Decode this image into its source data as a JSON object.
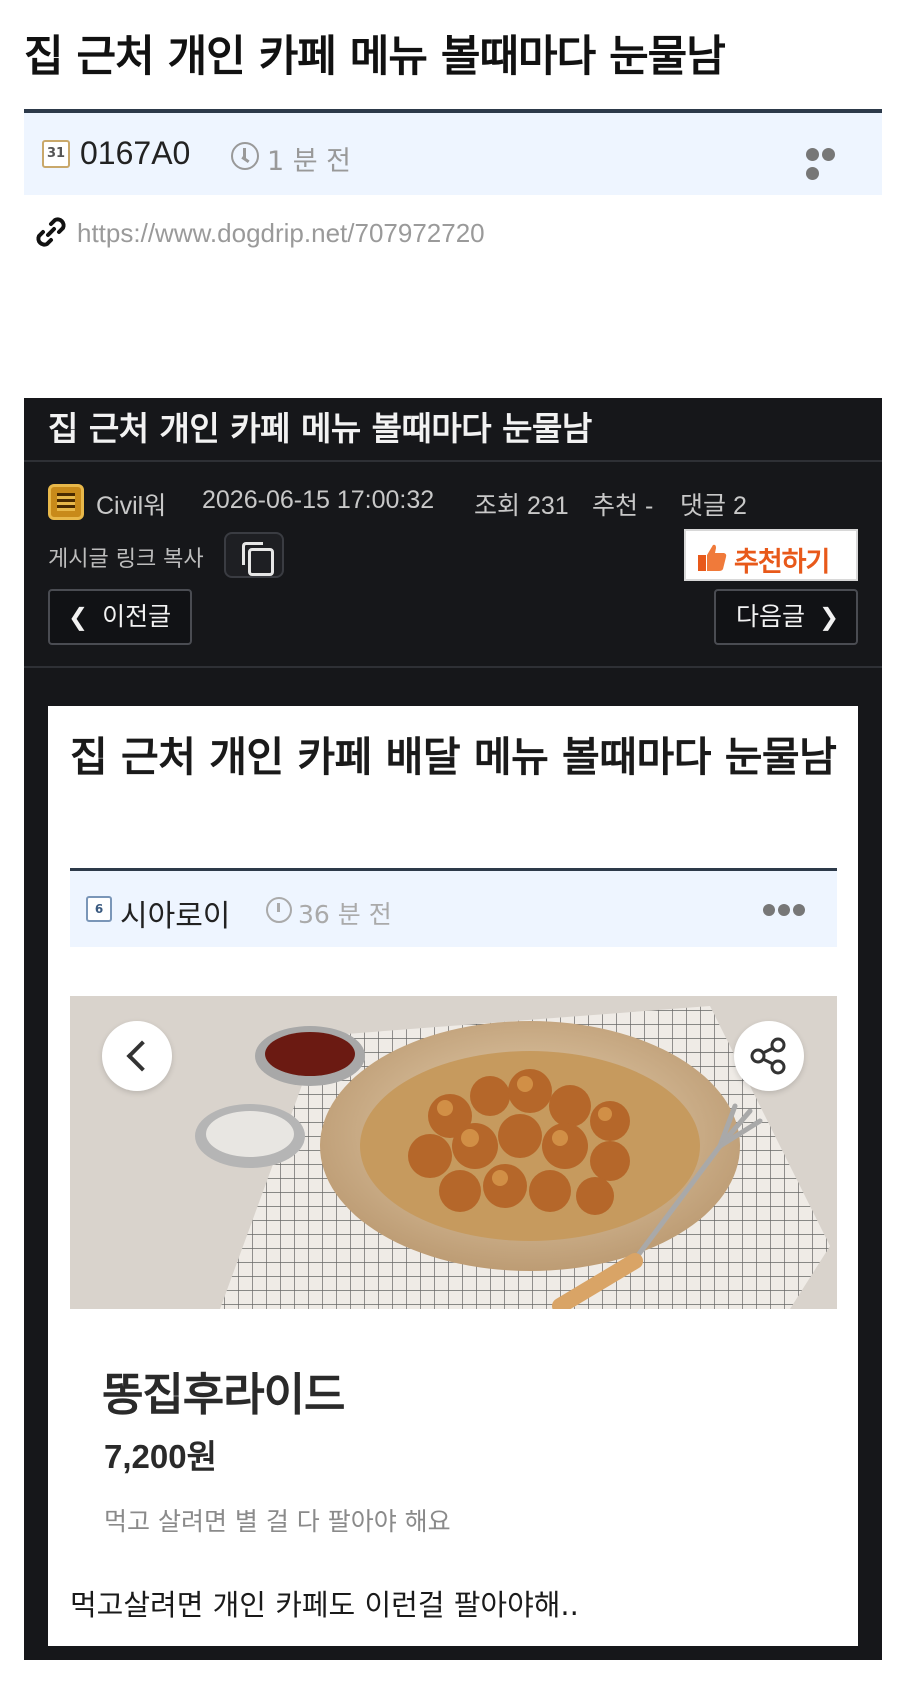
{
  "header": {
    "title": "집 근처 개인 카페 메뉴 볼때마다 눈물남",
    "level_badge": "31",
    "username": "0167A0",
    "time": "1 분 전",
    "source_url": "https://www.dogdrip.net/707972720"
  },
  "embed": {
    "title": "집 근처 개인 카페 메뉴 볼때마다 눈물남",
    "author": "Civil워",
    "datetime": "2026-06-15 17:00:32",
    "views": "조회 231",
    "recommend_count": "추천 -",
    "comments": "댓글 2",
    "copy_link_label": "게시글 링크 복사",
    "recommend_button": "추천하기",
    "prev_label": "이전글",
    "next_label": "다음글"
  },
  "inner_post": {
    "title": "집 근처 개인 카페 배달 메뉴 볼때마다 눈물남",
    "level_badge": "6",
    "username": "시아로이",
    "time": "36 분 전",
    "product_name": "똥집후라이드",
    "product_price": "7,200원",
    "product_desc": "먹고 살려면 별 걸 다 팔아야 해요",
    "comment": "먹고살려면 개인 카페도 이런걸 팔아야해.."
  },
  "colors": {
    "header_rule": "#2d3a4a",
    "meta_bar_bg": "#eef5ff",
    "embed_bg": "#16171a",
    "recommend_text": "#e8591a"
  },
  "icons": [
    "level-badge-icon",
    "clock-icon",
    "more-icon",
    "link-icon",
    "copy-icon",
    "thumbs-up-icon",
    "chevron-left-icon",
    "chevron-right-icon",
    "share-icon"
  ]
}
